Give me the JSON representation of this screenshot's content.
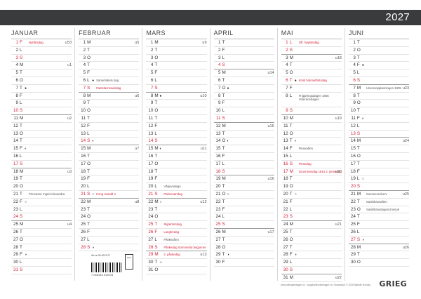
{
  "year": "2027",
  "months": [
    {
      "name": "JANUAR",
      "days": [
        {
          "n": "1",
          "w": "F",
          "red": true,
          "note": "Nyttårsdag",
          "wk": "u53"
        },
        {
          "n": "2",
          "w": "L"
        },
        {
          "n": "3",
          "w": "S",
          "red": true
        },
        {
          "n": "4",
          "w": "M",
          "wk": "u1"
        },
        {
          "n": "5",
          "w": "T"
        },
        {
          "n": "6",
          "w": "O"
        },
        {
          "n": "7",
          "w": "T",
          "moon": "●"
        },
        {
          "n": "8",
          "w": "F"
        },
        {
          "n": "9",
          "w": "L"
        },
        {
          "n": "10",
          "w": "S",
          "red": true,
          "sep": true
        },
        {
          "n": "11",
          "w": "M",
          "wk": "u2"
        },
        {
          "n": "12",
          "w": "T"
        },
        {
          "n": "13",
          "w": "O"
        },
        {
          "n": "14",
          "w": "T"
        },
        {
          "n": "15",
          "w": "F",
          "moon": "◐"
        },
        {
          "n": "16",
          "w": "L"
        },
        {
          "n": "17",
          "w": "S",
          "red": true,
          "sep": true
        },
        {
          "n": "18",
          "w": "M",
          "wk": "u3"
        },
        {
          "n": "19",
          "w": "T"
        },
        {
          "n": "20",
          "w": "O"
        },
        {
          "n": "21",
          "w": "T",
          "note": "Prinsesse Ingrid Alexandra"
        },
        {
          "n": "22",
          "w": "F",
          "moon": "○"
        },
        {
          "n": "23",
          "w": "L"
        },
        {
          "n": "24",
          "w": "S",
          "red": true,
          "sep": true
        },
        {
          "n": "25",
          "w": "M",
          "wk": "u4"
        },
        {
          "n": "26",
          "w": "T"
        },
        {
          "n": "27",
          "w": "O"
        },
        {
          "n": "28",
          "w": "T"
        },
        {
          "n": "29",
          "w": "F",
          "moon": "◑"
        },
        {
          "n": "30",
          "w": "L"
        },
        {
          "n": "31",
          "w": "S",
          "red": true
        }
      ]
    },
    {
      "name": "FEBRUAR",
      "days": [
        {
          "n": "1",
          "w": "M",
          "wk": "u5"
        },
        {
          "n": "2",
          "w": "T"
        },
        {
          "n": "3",
          "w": "O"
        },
        {
          "n": "4",
          "w": "T"
        },
        {
          "n": "5",
          "w": "F"
        },
        {
          "n": "6",
          "w": "L",
          "moon": "●",
          "note": "Samefolkets dag"
        },
        {
          "n": "7",
          "w": "S",
          "red": true,
          "sep": true,
          "note": "Fastelavnssøndag"
        },
        {
          "n": "8",
          "w": "M",
          "wk": "u6"
        },
        {
          "n": "9",
          "w": "T"
        },
        {
          "n": "10",
          "w": "O"
        },
        {
          "n": "11",
          "w": "T"
        },
        {
          "n": "12",
          "w": "F"
        },
        {
          "n": "13",
          "w": "L"
        },
        {
          "n": "14",
          "w": "S",
          "red": true,
          "sep": true,
          "moon": "◐"
        },
        {
          "n": "15",
          "w": "M",
          "wk": "u7"
        },
        {
          "n": "16",
          "w": "T"
        },
        {
          "n": "17",
          "w": "O"
        },
        {
          "n": "18",
          "w": "T"
        },
        {
          "n": "19",
          "w": "F"
        },
        {
          "n": "20",
          "w": "L"
        },
        {
          "n": "21",
          "w": "S",
          "red": true,
          "sep": true,
          "moon": "○",
          "note": "Kong Harald V"
        },
        {
          "n": "22",
          "w": "M",
          "wk": "u8"
        },
        {
          "n": "23",
          "w": "T"
        },
        {
          "n": "24",
          "w": "O"
        },
        {
          "n": "25",
          "w": "T"
        },
        {
          "n": "26",
          "w": "F"
        },
        {
          "n": "27",
          "w": "L"
        },
        {
          "n": "28",
          "w": "S",
          "red": true,
          "moon": "◑"
        }
      ]
    },
    {
      "name": "MARS",
      "days": [
        {
          "n": "1",
          "w": "M",
          "wk": "u9"
        },
        {
          "n": "2",
          "w": "T"
        },
        {
          "n": "3",
          "w": "O"
        },
        {
          "n": "4",
          "w": "T"
        },
        {
          "n": "5",
          "w": "F"
        },
        {
          "n": "6",
          "w": "L"
        },
        {
          "n": "7",
          "w": "S",
          "red": true,
          "sep": true
        },
        {
          "n": "8",
          "w": "M",
          "moon": "●",
          "wk": "u10"
        },
        {
          "n": "9",
          "w": "T"
        },
        {
          "n": "10",
          "w": "O"
        },
        {
          "n": "11",
          "w": "T"
        },
        {
          "n": "12",
          "w": "F"
        },
        {
          "n": "13",
          "w": "L"
        },
        {
          "n": "14",
          "w": "S",
          "red": true,
          "sep": true
        },
        {
          "n": "15",
          "w": "M",
          "moon": "◐",
          "wk": "u11"
        },
        {
          "n": "16",
          "w": "T"
        },
        {
          "n": "17",
          "w": "O"
        },
        {
          "n": "18",
          "w": "T"
        },
        {
          "n": "19",
          "w": "F"
        },
        {
          "n": "20",
          "w": "L",
          "note": "Vårjevndøgn"
        },
        {
          "n": "21",
          "w": "S",
          "red": true,
          "sep": true,
          "note": "Palmesøndag"
        },
        {
          "n": "22",
          "w": "M",
          "moon": "○",
          "wk": "u12"
        },
        {
          "n": "23",
          "w": "T"
        },
        {
          "n": "24",
          "w": "O"
        },
        {
          "n": "25",
          "w": "T",
          "red": true,
          "note": "Skjærtorsdag"
        },
        {
          "n": "26",
          "w": "F",
          "red": true,
          "note": "Langfredag"
        },
        {
          "n": "27",
          "w": "L",
          "note": "Påskeaften"
        },
        {
          "n": "28",
          "w": "S",
          "red": true,
          "sep": true,
          "note": "Påskedag Sommertid begynner"
        },
        {
          "n": "29",
          "w": "M",
          "red": true,
          "note": "2. påskedag",
          "wk": "u13"
        },
        {
          "n": "30",
          "w": "T",
          "moon": "◑"
        },
        {
          "n": "31",
          "w": "O"
        }
      ]
    },
    {
      "name": "APRIL",
      "days": [
        {
          "n": "1",
          "w": "T"
        },
        {
          "n": "2",
          "w": "F"
        },
        {
          "n": "3",
          "w": "L"
        },
        {
          "n": "4",
          "w": "S",
          "red": true,
          "sep": true
        },
        {
          "n": "5",
          "w": "M",
          "wk": "u14"
        },
        {
          "n": "6",
          "w": "T"
        },
        {
          "n": "7",
          "w": "O",
          "moon": "●"
        },
        {
          "n": "8",
          "w": "T"
        },
        {
          "n": "9",
          "w": "F"
        },
        {
          "n": "10",
          "w": "L"
        },
        {
          "n": "11",
          "w": "S",
          "red": true,
          "sep": true
        },
        {
          "n": "12",
          "w": "M",
          "wk": "u15"
        },
        {
          "n": "13",
          "w": "T"
        },
        {
          "n": "14",
          "w": "O",
          "moon": "◐"
        },
        {
          "n": "15",
          "w": "T"
        },
        {
          "n": "16",
          "w": "F"
        },
        {
          "n": "17",
          "w": "L"
        },
        {
          "n": "18",
          "w": "S",
          "red": true,
          "sep": true
        },
        {
          "n": "19",
          "w": "M",
          "wk": "u16"
        },
        {
          "n": "20",
          "w": "T"
        },
        {
          "n": "21",
          "w": "O",
          "moon": "○"
        },
        {
          "n": "22",
          "w": "T"
        },
        {
          "n": "23",
          "w": "F"
        },
        {
          "n": "24",
          "w": "L"
        },
        {
          "n": "25",
          "w": "S",
          "red": true,
          "sep": true
        },
        {
          "n": "26",
          "w": "M",
          "wk": "u17"
        },
        {
          "n": "27",
          "w": "T"
        },
        {
          "n": "28",
          "w": "O"
        },
        {
          "n": "29",
          "w": "T",
          "moon": "◑"
        },
        {
          "n": "30",
          "w": "F"
        }
      ]
    },
    {
      "name": "MAI",
      "days": [
        {
          "n": "1",
          "w": "L",
          "red": true,
          "note": "Off. høytidsdag"
        },
        {
          "n": "2",
          "w": "S",
          "red": true,
          "sep": true
        },
        {
          "n": "3",
          "w": "M",
          "wk": "u18"
        },
        {
          "n": "4",
          "w": "T"
        },
        {
          "n": "5",
          "w": "O"
        },
        {
          "n": "6",
          "w": "T",
          "red": true,
          "moon": "●",
          "note": "Kristi himmelfartsdag"
        },
        {
          "n": "7",
          "w": "F"
        },
        {
          "n": "8",
          "w": "L",
          "tall": true,
          "note": "Frigjøringsdagen 1945 Veteranedagen"
        },
        {
          "n": "9",
          "w": "S",
          "red": true,
          "sep": true
        },
        {
          "n": "10",
          "w": "M",
          "wk": "u19"
        },
        {
          "n": "11",
          "w": "T"
        },
        {
          "n": "12",
          "w": "O"
        },
        {
          "n": "13",
          "w": "T",
          "moon": "◐"
        },
        {
          "n": "14",
          "w": "F",
          "note": "Pinseaften"
        },
        {
          "n": "15",
          "w": "L"
        },
        {
          "n": "16",
          "w": "S",
          "red": true,
          "note": "Pinsedag"
        },
        {
          "n": "17",
          "w": "M",
          "red": true,
          "note": "Grunnlovsdag 1814 2. pinsedag",
          "wk": "u20"
        },
        {
          "n": "18",
          "w": "T"
        },
        {
          "n": "19",
          "w": "O"
        },
        {
          "n": "20",
          "w": "T",
          "moon": "○"
        },
        {
          "n": "21",
          "w": "F"
        },
        {
          "n": "22",
          "w": "L"
        },
        {
          "n": "23",
          "w": "S",
          "red": true,
          "sep": true
        },
        {
          "n": "24",
          "w": "M",
          "wk": "u21"
        },
        {
          "n": "25",
          "w": "T"
        },
        {
          "n": "26",
          "w": "O"
        },
        {
          "n": "27",
          "w": "T"
        },
        {
          "n": "28",
          "w": "F",
          "moon": "◑"
        },
        {
          "n": "29",
          "w": "L"
        },
        {
          "n": "30",
          "w": "S",
          "red": true,
          "sep": true
        },
        {
          "n": "31",
          "w": "M",
          "wk": "u22"
        }
      ]
    },
    {
      "name": "JUNI",
      "days": [
        {
          "n": "1",
          "w": "T"
        },
        {
          "n": "2",
          "w": "O"
        },
        {
          "n": "3",
          "w": "T"
        },
        {
          "n": "4",
          "w": "F",
          "moon": "●"
        },
        {
          "n": "5",
          "w": "L"
        },
        {
          "n": "6",
          "w": "S",
          "red": true,
          "sep": true
        },
        {
          "n": "7",
          "w": "M",
          "note": "Unionsoppløsningen 1905",
          "wk": "u23"
        },
        {
          "n": "8",
          "w": "T"
        },
        {
          "n": "9",
          "w": "O"
        },
        {
          "n": "10",
          "w": "T"
        },
        {
          "n": "11",
          "w": "F",
          "moon": "◐"
        },
        {
          "n": "12",
          "w": "L"
        },
        {
          "n": "13",
          "w": "S",
          "red": true,
          "sep": true
        },
        {
          "n": "14",
          "w": "M",
          "wk": "u24"
        },
        {
          "n": "15",
          "w": "T"
        },
        {
          "n": "16",
          "w": "O"
        },
        {
          "n": "17",
          "w": "T"
        },
        {
          "n": "18",
          "w": "F"
        },
        {
          "n": "19",
          "w": "L",
          "moon": "○"
        },
        {
          "n": "20",
          "w": "S",
          "red": true,
          "sep": true
        },
        {
          "n": "21",
          "w": "M",
          "note": "Sommersolverv",
          "wk": "u25"
        },
        {
          "n": "22",
          "w": "T",
          "note": "Sankthansaften"
        },
        {
          "n": "23",
          "w": "O",
          "note": "Sankthansdagen/Jonsok"
        },
        {
          "n": "24",
          "w": "T"
        },
        {
          "n": "25",
          "w": "F"
        },
        {
          "n": "26",
          "w": "L"
        },
        {
          "n": "27",
          "w": "S",
          "red": true,
          "sep": true,
          "moon": "◑"
        },
        {
          "n": "28",
          "w": "M",
          "wk": "u26"
        },
        {
          "n": "29",
          "w": "T"
        },
        {
          "n": "30",
          "w": "O"
        }
      ]
    }
  ],
  "footer": {
    "article": "Art.nr 95 4013 27",
    "barcode_number": "7 045144 019278",
    "fsc": "FSC",
    "url": "www.arkivplanlegger.no · salg@arkivplanlegger.no / Illustrasjon © 2026 Bjørkås Norway",
    "brand": "GRIEG"
  }
}
